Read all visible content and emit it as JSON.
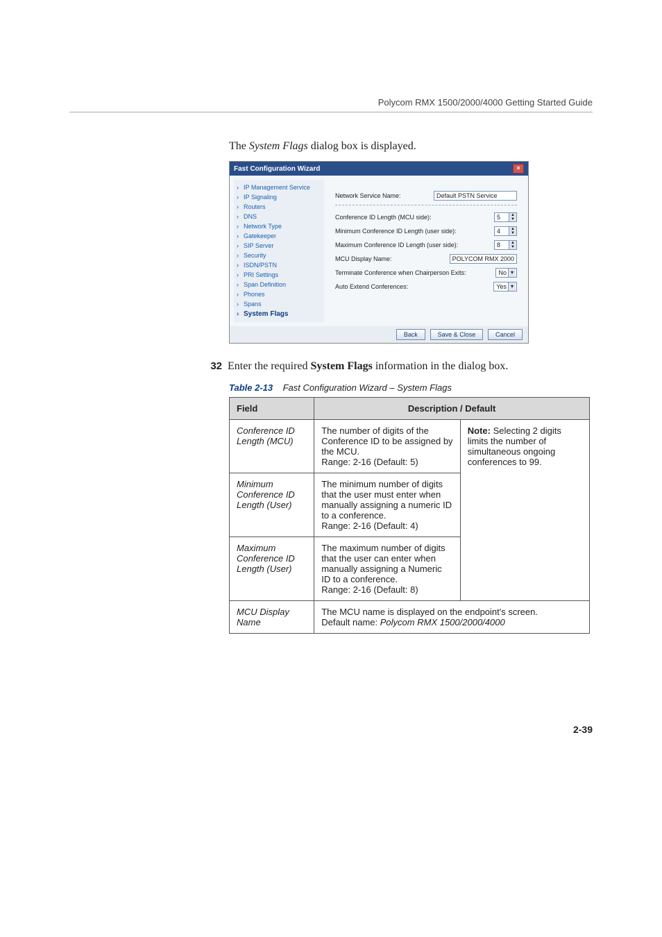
{
  "header_meta": "Polycom RMX 1500/2000/4000 Getting Started Guide",
  "intro": {
    "pre": "The ",
    "em": "System Flags",
    "post": " dialog box is displayed."
  },
  "dialog": {
    "title": "Fast Configuration Wizard",
    "close_glyph": "×",
    "sidebar": [
      "IP Management Service",
      "IP Signaling",
      "Routers",
      "DNS",
      "Network Type",
      "Gatekeeper",
      "SIP Server",
      "Security",
      "ISDN/PSTN",
      "PRI Settings",
      "Span Definition",
      "Phones",
      "Spans",
      "System Flags"
    ],
    "sidebar_selected_index": 13,
    "service_name_label": "Network Service Name:",
    "service_name_value": "Default PSTN Service",
    "rows": [
      {
        "label": "Conference ID Length (MCU side):",
        "value": "5",
        "type": "spin"
      },
      {
        "label": "Minimum Conference ID Length (user side):",
        "value": "4",
        "type": "spin"
      },
      {
        "label": "Maximum Conference ID Length (user side):",
        "value": "8",
        "type": "spin"
      },
      {
        "label": "MCU Display Name:",
        "value": "POLYCOM RMX 2000",
        "type": "text"
      },
      {
        "label": "Terminate Conference when Chairperson Exits:",
        "value": "No",
        "type": "select"
      },
      {
        "label": "Auto Extend Conferences:",
        "value": "Yes",
        "type": "select"
      }
    ],
    "buttons": {
      "back": "Back",
      "save": "Save & Close",
      "cancel": "Cancel"
    }
  },
  "step": {
    "num": "32",
    "pre": "Enter the required ",
    "bold": "System Flags",
    "post": " information in the dialog box."
  },
  "table_caption": {
    "lead": "Table 2-13",
    "tail": "Fast Configuration Wizard – System Flags"
  },
  "table_headers": {
    "field": "Field",
    "desc": "Description / Default"
  },
  "table_note": {
    "bold": "Note:",
    "rest": " Selecting 2 digits limits the number of simultaneous ongoing conferences to 99."
  },
  "table_rows": [
    {
      "field": "Conference ID Length (MCU)",
      "desc_pre": "The number of digits of the Conference ID to be assigned by the MCU.",
      "desc_range": "Range: 2-16 (Default: 5)"
    },
    {
      "field": "Minimum Conference ID Length (User)",
      "desc_pre": "The minimum number of digits that the user must enter when manually assigning a numeric ID to a conference.",
      "desc_range": "Range: 2-16 (Default: 4)"
    },
    {
      "field": "Maximum Conference ID Length (User)",
      "desc_pre": "The maximum number of digits that the user can enter when manually assigning a Numeric ID to a conference.",
      "desc_range": "Range: 2-16 (Default: 8)"
    },
    {
      "field": "MCU Display Name",
      "desc_line1": "The MCU name is displayed on the endpoint's screen.",
      "desc_line2_pre": "Default name: ",
      "desc_line2_em": "Polycom RMX 1500/2000/4000"
    }
  ],
  "page_number": "2-39"
}
